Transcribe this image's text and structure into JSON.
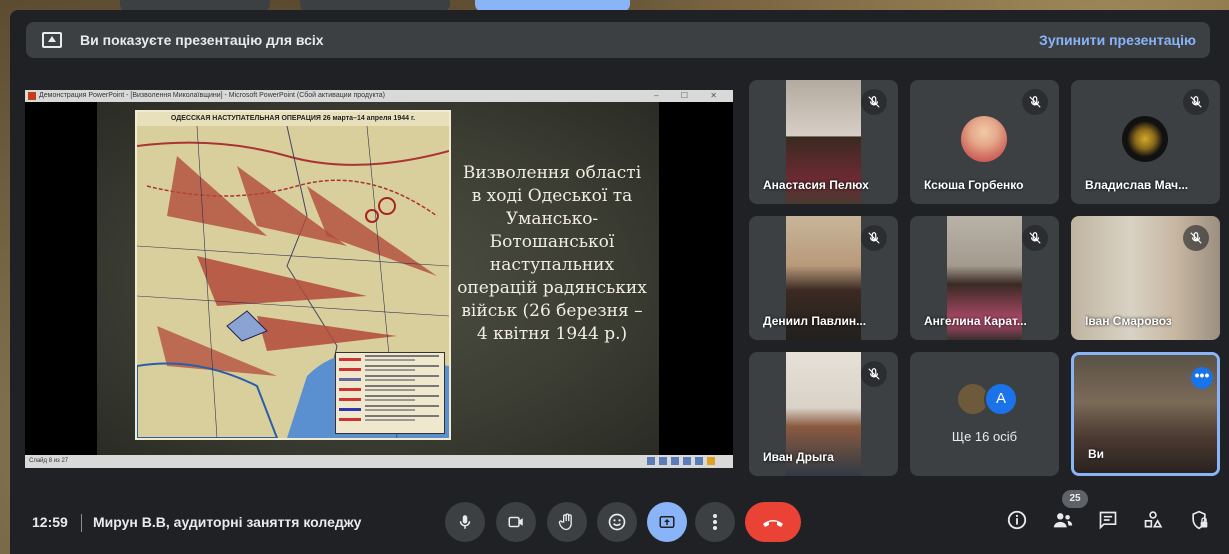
{
  "banner": {
    "text": "Ви показуєте презентацію для всіх",
    "stop_label": "Зупинити презентацію"
  },
  "presentation": {
    "window_title": "Демонстрация PowerPoint - [Визволення Миколаївщини] - Microsoft PowerPoint (Сбой активации продукта)",
    "map_title": "ОДЕССКАЯ НАСТУПАТЕЛЬНАЯ ОПЕРАЦИЯ 26 марта–14 апреля 1944 г.",
    "slide_text": "Визволення області в ході Одеської та Уманськo-Ботошанської наступальних операцій радянських військ (26 березня – 4 квітня 1944 р.)",
    "status_text": "Слайд 8 из 27"
  },
  "participants": [
    {
      "name": "Анастасия Пелюх",
      "muted": true
    },
    {
      "name": "Ксюша Горбенко",
      "muted": true
    },
    {
      "name": "Владислав Мач...",
      "muted": true
    },
    {
      "name": "Дениил Павлин...",
      "muted": true
    },
    {
      "name": "Ангелина Карат...",
      "muted": true
    },
    {
      "name": "Іван Смаровоз",
      "muted": true
    },
    {
      "name": "Иван Дрыга",
      "muted": true
    }
  ],
  "others": {
    "initial": "A",
    "label": "Ще 16 осіб"
  },
  "self_tile": {
    "name": "Ви",
    "more": "•••"
  },
  "bottom_bar": {
    "time": "12:59",
    "meeting": "Мирун В.В, аудиторні заняття коледжу",
    "people_count": "25"
  },
  "icons": {
    "mic": "mic-icon",
    "camera": "camera-icon",
    "hand": "raise-hand-icon",
    "emoji": "emoji-icon",
    "present": "present-icon",
    "more": "more-vert-icon",
    "end": "end-call-icon",
    "info": "info-icon",
    "people": "people-icon",
    "chat": "chat-icon",
    "activities": "activities-icon",
    "lock": "host-controls-icon"
  },
  "colors": {
    "accent": "#8ab4f8",
    "end_call": "#ea4335",
    "panel": "#3c4043",
    "background": "#202124"
  }
}
